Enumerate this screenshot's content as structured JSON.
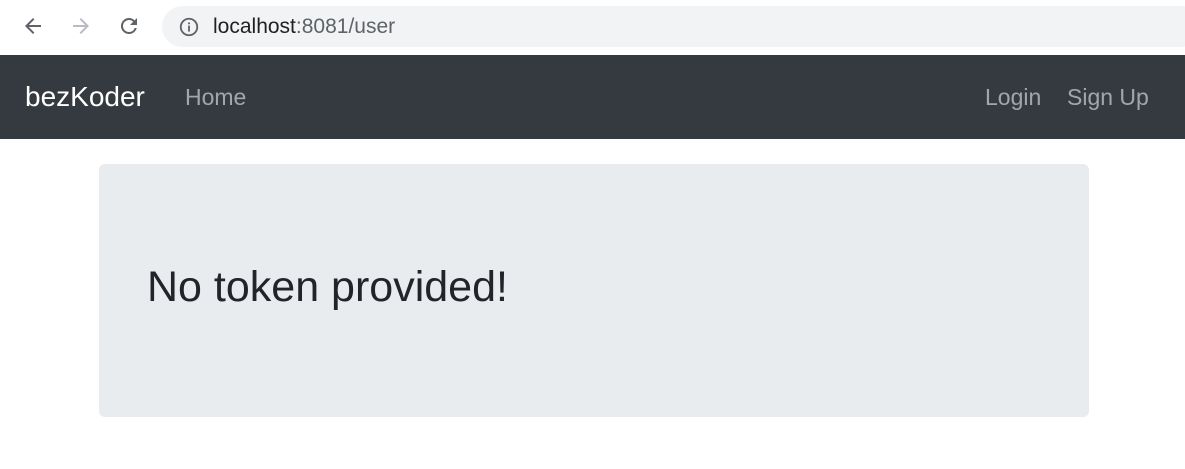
{
  "browser": {
    "url_host": "localhost",
    "url_rest": ":8081/user",
    "icons": {
      "back": "arrow-left-icon",
      "forward": "arrow-right-icon",
      "reload": "reload-icon",
      "site_info": "info-icon"
    },
    "forward_enabled": false
  },
  "navbar": {
    "brand": "bezKoder",
    "home": "Home",
    "login": "Login",
    "signup": "Sign Up",
    "colors": {
      "background": "#343a40",
      "brand": "#ffffff",
      "link": "rgba(255,255,255,0.55)"
    }
  },
  "main": {
    "message": "No token provided!",
    "colors": {
      "panel": "#e9ecef",
      "text": "#212529"
    }
  }
}
